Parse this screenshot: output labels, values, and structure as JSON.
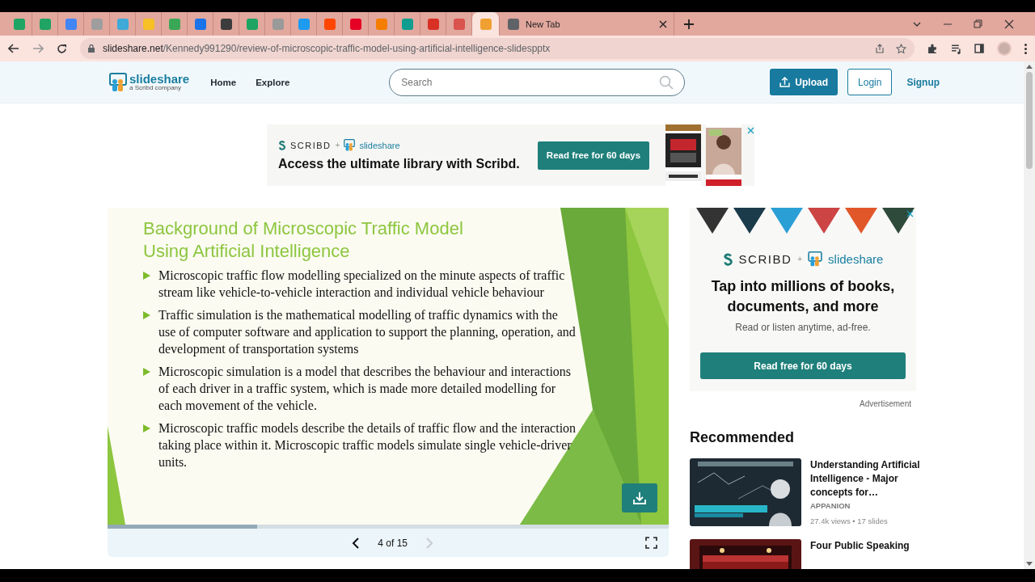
{
  "browser": {
    "tabs": [
      {
        "selected": false,
        "color": "#1fa463"
      },
      {
        "selected": false,
        "color": "#1fa463"
      },
      {
        "selected": false,
        "color": "#4285f4"
      },
      {
        "selected": false,
        "color": "#9e9e9e"
      },
      {
        "selected": false,
        "color": "#3fa9d8"
      },
      {
        "selected": false,
        "color": "#f6c026"
      },
      {
        "selected": false,
        "color": "#3aa757"
      },
      {
        "selected": false,
        "color": "#1a73e8"
      },
      {
        "selected": false,
        "color": "#3c3c3c"
      },
      {
        "selected": false,
        "color": "#1da462"
      },
      {
        "selected": false,
        "color": "#9a9a9a"
      },
      {
        "selected": false,
        "color": "#1d9bf0"
      },
      {
        "selected": false,
        "color": "#ff4500"
      },
      {
        "selected": false,
        "color": "#e60023"
      },
      {
        "selected": false,
        "color": "#f57d00"
      },
      {
        "selected": false,
        "color": "#0f9d8f"
      },
      {
        "selected": false,
        "color": "#d93025"
      },
      {
        "selected": false,
        "color": "#d9534f"
      },
      {
        "selected": true,
        "color": "#f0a030"
      },
      {
        "selected": false,
        "color": "#5f6368",
        "title": "New Tab"
      }
    ],
    "url_host": "slideshare.net",
    "url_path": "/Kennedy991290/review-of-microscopic-traffic-model-using-artificial-intelligence-slidespptx"
  },
  "header": {
    "logo": "slideshare",
    "logo_sub": "a Scribd company",
    "nav": [
      "Home",
      "Explore"
    ],
    "search": {
      "placeholder": "Search"
    },
    "upload": "Upload",
    "login": "Login",
    "signup": "Signup"
  },
  "top_ad": {
    "scribd": "SCRIBD",
    "plus": "+",
    "slideshare": "slideshare",
    "headline": "Access the ultimate library with Scribd.",
    "button": "Read free for 60 days"
  },
  "slide": {
    "title": "Background of Microscopic Traffic Model Using Artificial Intelligence",
    "bullets": [
      "Microscopic traffic flow modelling specialized on the minute aspects of traffic stream like vehicle-to-vehicle interaction and individual vehicle behaviour",
      "Traffic simulation is the mathematical modelling of traffic dynamics with the use of computer software and application to support the planning, operation, and development of transportation systems",
      "Microscopic simulation is a model that describes the behaviour and interactions of each driver in a traffic system, which is made more detailed modelling for each movement of the vehicle.",
      "Microscopic traffic models describe the details of traffic flow and the interaction taking place within it. Microscopic traffic models simulate single vehicle-driver units."
    ],
    "progress": {
      "level": 0.267
    },
    "counter": "4 of 15",
    "next_disabled": true
  },
  "side_ad": {
    "scribd": "SCRIBD",
    "plus": "+",
    "slideshare": "slideshare",
    "headline": "Tap into millions of books, documents, and more",
    "sub": "Read or listen anytime, ad-free.",
    "button": "Read free for 60 days",
    "note": "Advertisement"
  },
  "recommended": {
    "heading": "Recommended",
    "items": [
      {
        "title": "Understanding Artificial Intelligence - Major concepts for…",
        "author": "APPANION",
        "meta": "27.4k views • 17 slides"
      },
      {
        "title": "Four Public Speaking"
      }
    ]
  }
}
